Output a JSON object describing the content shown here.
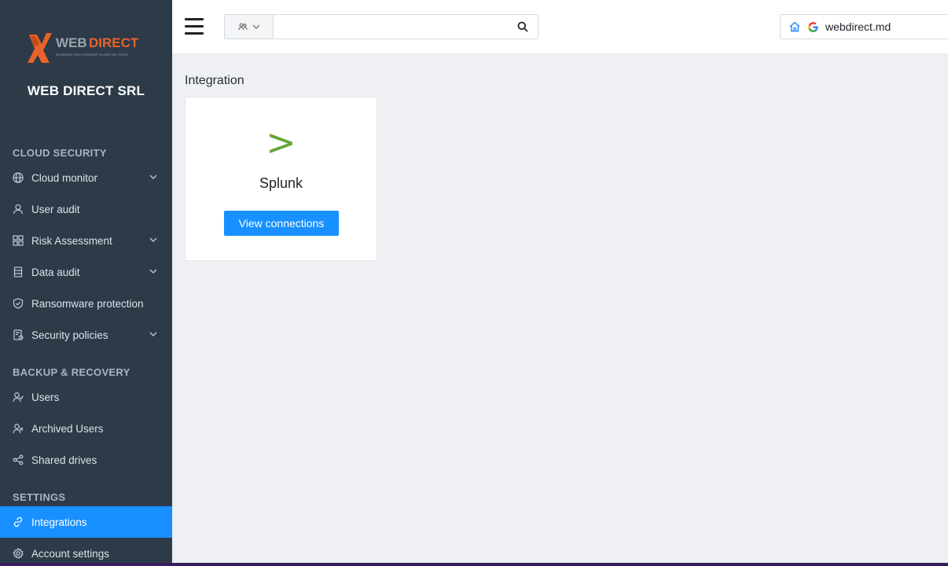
{
  "sidebar": {
    "logo_text": "WEB DIRECT",
    "logo_tagline": "BUSINESS RELATIONSHIP BASED ON TRUST",
    "company": "WEB DIRECT SRL",
    "sections": {
      "cloud_security": "CLOUD SECURITY",
      "backup_recovery": "BACKUP & RECOVERY",
      "settings": "SETTINGS"
    },
    "items": [
      {
        "label": "Cloud monitor",
        "icon": "globe-icon",
        "expandable": true
      },
      {
        "label": "User audit",
        "icon": "user-icon",
        "expandable": false
      },
      {
        "label": "Risk Assessment",
        "icon": "grid-icon",
        "expandable": true
      },
      {
        "label": "Data audit",
        "icon": "database-icon",
        "expandable": true
      },
      {
        "label": "Ransomware protection",
        "icon": "shield-icon",
        "expandable": false
      },
      {
        "label": "Security policies",
        "icon": "policy-icon",
        "expandable": true
      },
      {
        "label": "Users",
        "icon": "users-icon",
        "expandable": false
      },
      {
        "label": "Archived Users",
        "icon": "archived-users-icon",
        "expandable": false
      },
      {
        "label": "Shared drives",
        "icon": "share-icon",
        "expandable": false
      },
      {
        "label": "Integrations",
        "icon": "link-icon",
        "expandable": false,
        "active": true
      },
      {
        "label": "Account settings",
        "icon": "gear-icon",
        "expandable": false
      }
    ]
  },
  "header": {
    "search": {
      "placeholder": "",
      "value": ""
    },
    "domain": "webdirect.md"
  },
  "main": {
    "title": "Integration",
    "cards": [
      {
        "name": "Splunk",
        "logo": ">",
        "button": "View connections"
      }
    ]
  },
  "colors": {
    "sidebar_bg": "#2d3a48",
    "accent": "#1890ff",
    "splunk_green": "#65a637",
    "content_bg": "#eef0f4"
  }
}
